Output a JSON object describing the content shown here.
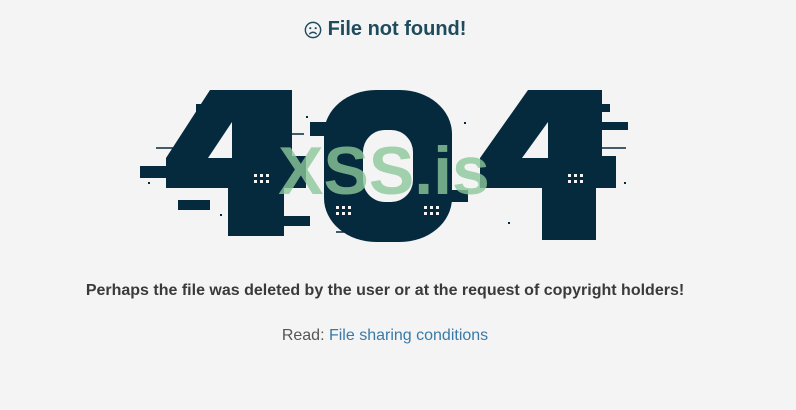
{
  "header": {
    "icon": "sad-face-icon",
    "title": "File not found!"
  },
  "illustration": {
    "code_text": "404",
    "watermark": "XSS.is",
    "digit_color": "#062a3d",
    "watermark_color": "#8bc79a"
  },
  "message": {
    "text": "Perhaps the file was deleted by the user or at the request of copyright holders!"
  },
  "read": {
    "prefix": "Read: ",
    "link_label": "File sharing conditions"
  },
  "colors": {
    "background": "#f4f4f4",
    "title": "#1f4c5c",
    "link": "#3a7aa8"
  }
}
